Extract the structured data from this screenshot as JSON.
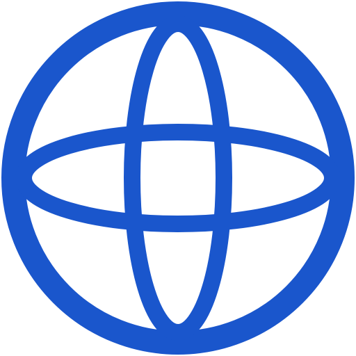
{
  "icon": {
    "name": "globe-icon",
    "color": "#1A56CC",
    "background": "#FFFFFF"
  }
}
